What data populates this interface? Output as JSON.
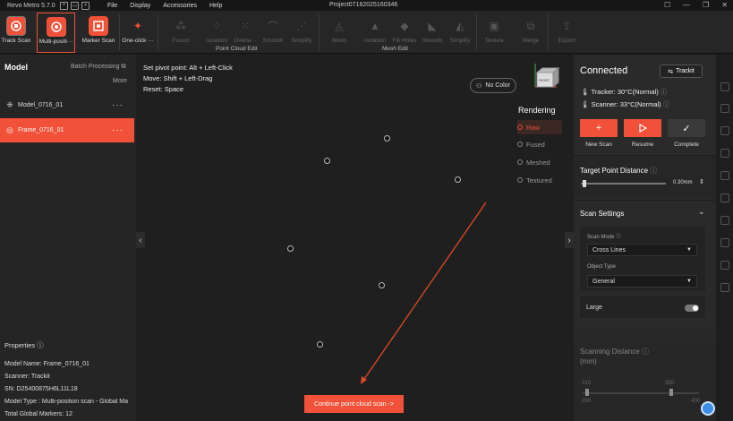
{
  "titlebar": {
    "app_name": "Revo Metro 5.7.0",
    "project": "Project07162025160346",
    "menu": [
      "File",
      "Display",
      "Accessories",
      "Help"
    ],
    "win_controls": [
      "☐",
      "—",
      "❐",
      "✕"
    ]
  },
  "toolbar": {
    "scan_buttons": [
      {
        "label": "Track Scan",
        "icon": "track-scan-icon"
      },
      {
        "label": "Multi-positi···",
        "icon": "multi-position-scan-icon"
      },
      {
        "label": "Marker Scan",
        "icon": "marker-scan-icon"
      }
    ],
    "one_click": {
      "label": "One-click ···",
      "icon": "wand-icon"
    },
    "point_cloud_edit": {
      "group_label": "Point Cloud Edit",
      "items": [
        "Fusion",
        "Isolation",
        "Overla···",
        "Smooth",
        "Simplify"
      ]
    },
    "mesh_edit": {
      "group_label": "Mesh Edit",
      "items": [
        "Mesh",
        "Isolation",
        "Fill Holes",
        "Smooth",
        "Simplify"
      ]
    },
    "tail_items": [
      "Texture",
      "Merge",
      "Export"
    ]
  },
  "left_panel": {
    "title": "Model",
    "batch_processing": "Batch Processing",
    "more": "More",
    "models": [
      {
        "name": "Model_0716_01",
        "selected": false
      },
      {
        "name": "Frame_0716_01",
        "selected": true
      }
    ],
    "properties_title": "Properties",
    "properties": [
      "Model Name:  Frame_0716_01",
      "Scanner:  Trackit",
      "SN:  D25400875H6L11L18",
      "Model Type :  Multi-position scan - Global Ma",
      "Total Global Markers:  12"
    ]
  },
  "viewport": {
    "hints": [
      {
        "key": "Set pivot point:",
        "value": "Alt + Left-Click"
      },
      {
        "key": "Move:",
        "value": "Shift + Left-Drag"
      },
      {
        "key": "Reset:",
        "value": "Space"
      }
    ],
    "no_color": "No Color",
    "rendering_title": "Rendering",
    "rendering_options": [
      {
        "label": "Raw",
        "selected": true
      },
      {
        "label": "Fused",
        "selected": false
      },
      {
        "label": "Meshed",
        "selected": false
      },
      {
        "label": "Textured",
        "selected": false
      }
    ],
    "axis_cube": "FRONT",
    "continue_button": "Continue point cloud scan  ->"
  },
  "right_panel": {
    "status": "Connected",
    "device_button": "Trackit",
    "tracker_label": "Tracker:",
    "tracker_temp": "30°C(Normal)",
    "scanner_label": "Scanner:",
    "scanner_temp": "33°C(Normal)",
    "actions": [
      {
        "label": "New Scan",
        "icon": "plus-icon"
      },
      {
        "label": "Resume",
        "icon": "play-icon"
      },
      {
        "label": "Complete",
        "icon": "check-icon"
      }
    ],
    "target_point_distance": "Target Point Distance",
    "target_value": "0.30mm",
    "scan_settings": "Scan Settings",
    "scan_mode_label": "Scan Mode",
    "scan_mode_value": "Cross Lines",
    "object_type_label": "Object Type",
    "object_type_value": "General",
    "large_label": "Large",
    "large_enabled": false,
    "scanning_distance": "Scanning Distance",
    "scanning_distance_unit": "(mm)",
    "range_ticks_top": [
      "210",
      "350"
    ],
    "range_ticks_bottom": [
      "200",
      "400"
    ]
  },
  "colors": {
    "accent": "#f05138",
    "panel": "#2a2a2a",
    "viewport": "#1f1f1f"
  }
}
